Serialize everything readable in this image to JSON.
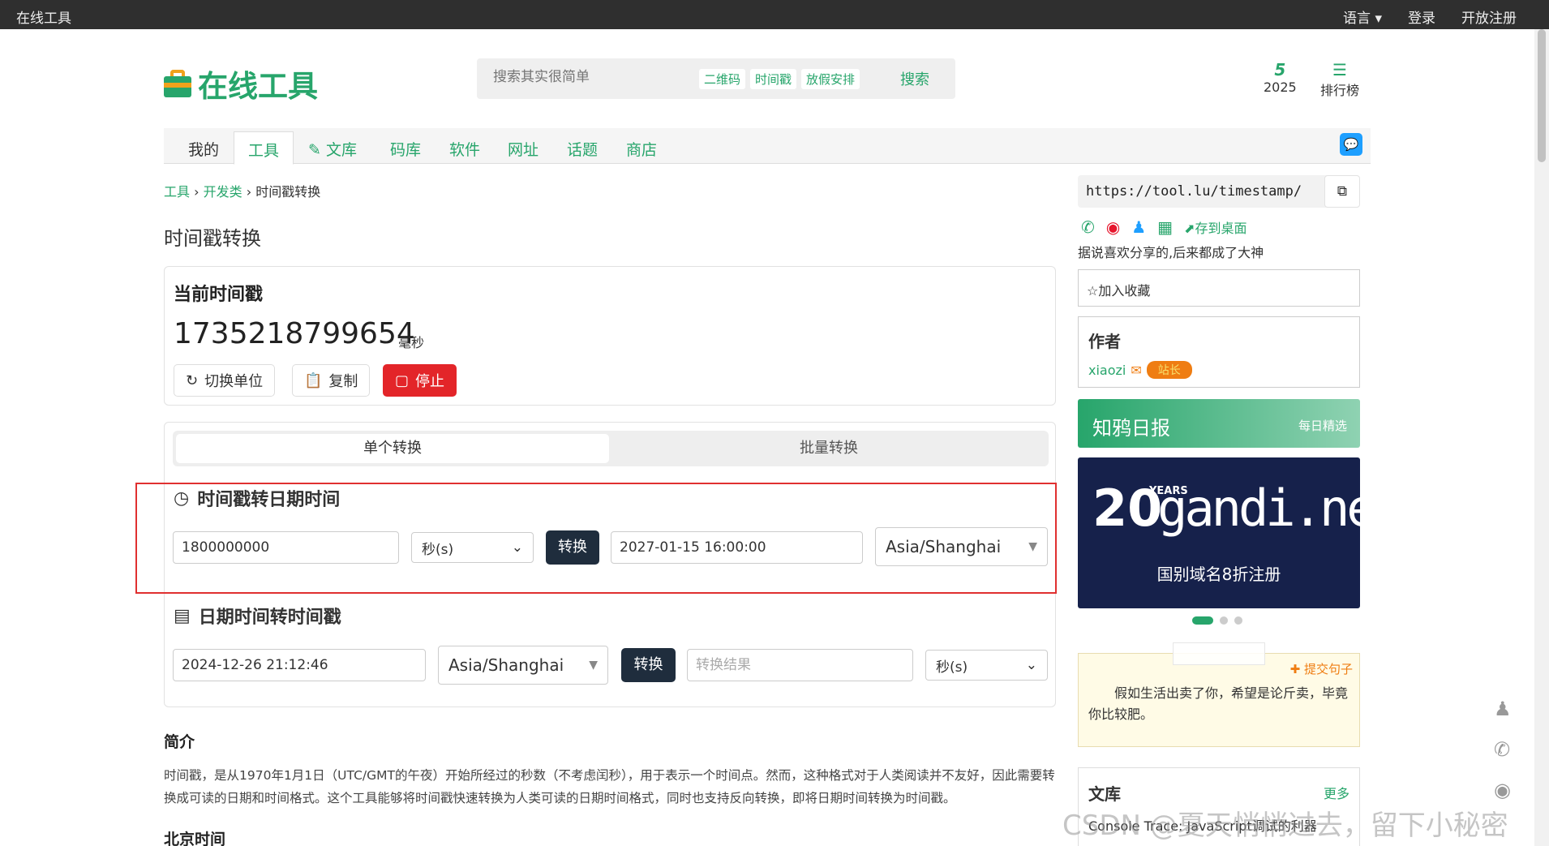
{
  "topbar": {
    "brand": "在线工具",
    "lang": "语言",
    "login": "登录",
    "register": "开放注册"
  },
  "logo": {
    "text": "在线工具"
  },
  "search": {
    "placeholder": "搜索其实很简单",
    "tags": [
      "二维码",
      "时间戳",
      "放假安排"
    ],
    "button": "搜索"
  },
  "stats": [
    {
      "value": "5",
      "label": "2025"
    },
    {
      "value": "☰",
      "label": "排行榜"
    }
  ],
  "nav": {
    "items": [
      "我的",
      "工具",
      "文库",
      "码库",
      "软件",
      "网址",
      "话题",
      "商店"
    ]
  },
  "breadcrumb": {
    "a": "工具",
    "b": "开发类",
    "c": "时间戳转换",
    "sep": "›"
  },
  "page_title": "时间戳转换",
  "current": {
    "title": "当前时间戳",
    "timestamp": "1735218799654",
    "unit": "毫秒",
    "btn_switch": "切换单位",
    "btn_copy": "复制",
    "btn_stop": "停止"
  },
  "tabs": [
    "单个转换",
    "批量转换"
  ],
  "ts2date": {
    "title": "时间戳转日期时间",
    "input": "1800000000",
    "unit": "秒(s)",
    "button": "转换",
    "result": "2027-01-15 16:00:00",
    "tz": "Asia/Shanghai"
  },
  "date2ts": {
    "title": "日期时间转时间戳",
    "input": "2024-12-26 21:12:46",
    "tz": "Asia/Shanghai",
    "button": "转换",
    "placeholder": "转换结果",
    "unit": "秒(s)"
  },
  "intro": {
    "title": "简介",
    "text": "时间戳，是从1970年1月1日（UTC/GMT的午夜）开始所经过的秒数（不考虑闰秒），用于表示一个时间点。然而，这种格式对于人类阅读并不友好，因此需要转换成可读的日期和时间格式。这个工具能够将时间戳快速转换为人类可读的日期时间格式，同时也支持反向转换，即将日期时间转换为时间戳。"
  },
  "beijing": {
    "title": "北京时间"
  },
  "side": {
    "url": "https://tool.lu/timestamp/",
    "save_desktop": "存到桌面",
    "share_note": "据说喜欢分享的,后来都成了大神",
    "fav": "加入收藏",
    "author_title": "作者",
    "author_name": "xiaozi",
    "author_badge": "站长",
    "zhi_title": "知鸦日报",
    "zhi_sub": "每日精选",
    "ad_num": "20",
    "ad_years": "YEARS",
    "ad_domain": "gandi.net",
    "ad_caption": "国别域名8折注册",
    "quote_submit": "提交句子",
    "quote_text": "假如生活出卖了你，希望是论斤卖，毕竟你比较肥。",
    "lib_title": "文库",
    "lib_more": "更多",
    "lib_item": "Console Trace: JavaScript调试的利器"
  },
  "watermark": "CSDN @夏天悄悄过去，留下小秘密"
}
